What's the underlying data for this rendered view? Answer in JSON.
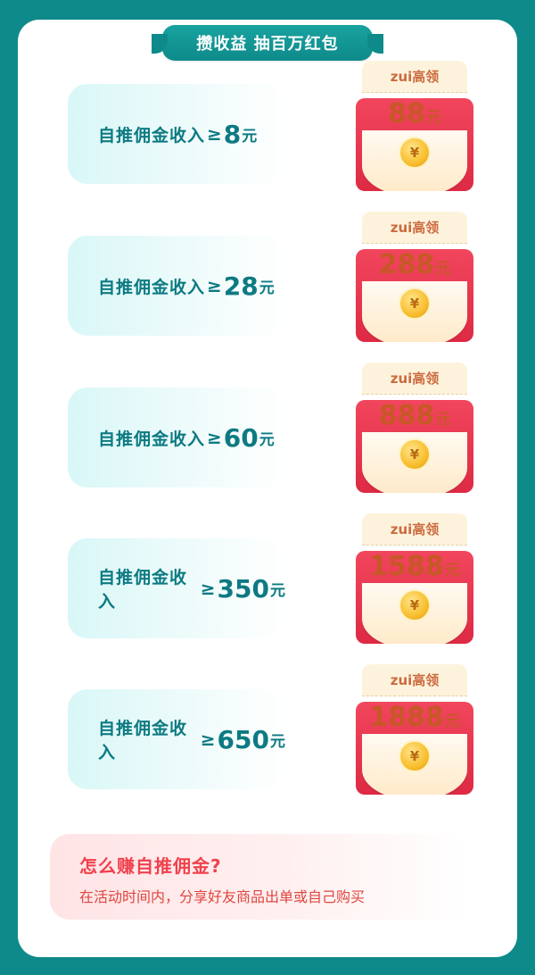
{
  "header": {
    "title": "攒收益 抽百万红包"
  },
  "tiers": [
    {
      "label": "自推佣金收入",
      "ge": "≥",
      "amount": "8",
      "unit": "元",
      "reward_tag": "zui高领",
      "reward_value": "88",
      "reward_unit": "元",
      "coin": "¥"
    },
    {
      "label": "自推佣金收入",
      "ge": "≥",
      "amount": "28",
      "unit": "元",
      "reward_tag": "zui高领",
      "reward_value": "288",
      "reward_unit": "元",
      "coin": "¥"
    },
    {
      "label": "自推佣金收入",
      "ge": "≥",
      "amount": "60",
      "unit": "元",
      "reward_tag": "zui高领",
      "reward_value": "888",
      "reward_unit": "元",
      "coin": "¥"
    },
    {
      "label": "自推佣金收入",
      "ge": "≥",
      "amount": "350",
      "unit": "元",
      "reward_tag": "zui高领",
      "reward_value": "1588",
      "reward_unit": "元",
      "coin": "¥"
    },
    {
      "label": "自推佣金收入",
      "ge": "≥",
      "amount": "650",
      "unit": "元",
      "reward_tag": "zui高领",
      "reward_value": "1888",
      "reward_unit": "元",
      "coin": "¥"
    }
  ],
  "howto": {
    "title": "怎么赚自推佣金?",
    "desc": "在活动时间内，分享好友商品出单或自己购买"
  },
  "colors": {
    "background": "#0e8a8a",
    "tier_text": "#0d7a82",
    "envelope_red": "#e8354e",
    "reward_text": "#c85728",
    "howto_title": "#f0414d"
  }
}
